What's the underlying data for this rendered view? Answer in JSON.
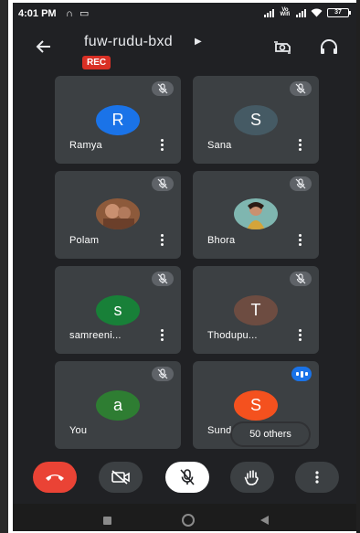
{
  "status_bar": {
    "time": "4:01 PM",
    "left_icons": [
      "headset-icon",
      "cast-icon"
    ],
    "network_label": "Vo Wifi",
    "battery": "37"
  },
  "header": {
    "meeting_code": "fuw-rudu-bxd",
    "recording_badge": "REC",
    "icons": [
      "back-arrow-icon",
      "switch-camera-icon",
      "headphones-icon"
    ]
  },
  "participants": [
    {
      "name": "Ramya",
      "initial": "R",
      "avatar_color": "#1a73e8",
      "muted": true
    },
    {
      "name": "Sana",
      "initial": "S",
      "avatar_color": "#455a64",
      "muted": true
    },
    {
      "name": "Polam",
      "initial": "",
      "photo": true,
      "muted": true
    },
    {
      "name": "Bhora",
      "initial": "",
      "photo": true,
      "muted": true
    },
    {
      "name": "samreeni...",
      "initial": "s",
      "avatar_color": "#188038",
      "muted": true
    },
    {
      "name": "Thodupu...",
      "initial": "T",
      "avatar_color": "#6d4c41",
      "muted": true
    },
    {
      "name": "You",
      "initial": "a",
      "avatar_color": "#2e7d32",
      "muted": true
    },
    {
      "name": "Sund",
      "initial": "S",
      "avatar_color": "#f4511e",
      "speaking": true,
      "others_label": "50 others"
    }
  ],
  "controls": {
    "end_call_color": "#ea4335",
    "items": [
      "end-call",
      "camera-off",
      "mic-off",
      "raise-hand",
      "more-options"
    ]
  },
  "colors": {
    "background": "#202124",
    "tile": "#3c4043",
    "accent_blue": "#1a73e8"
  }
}
